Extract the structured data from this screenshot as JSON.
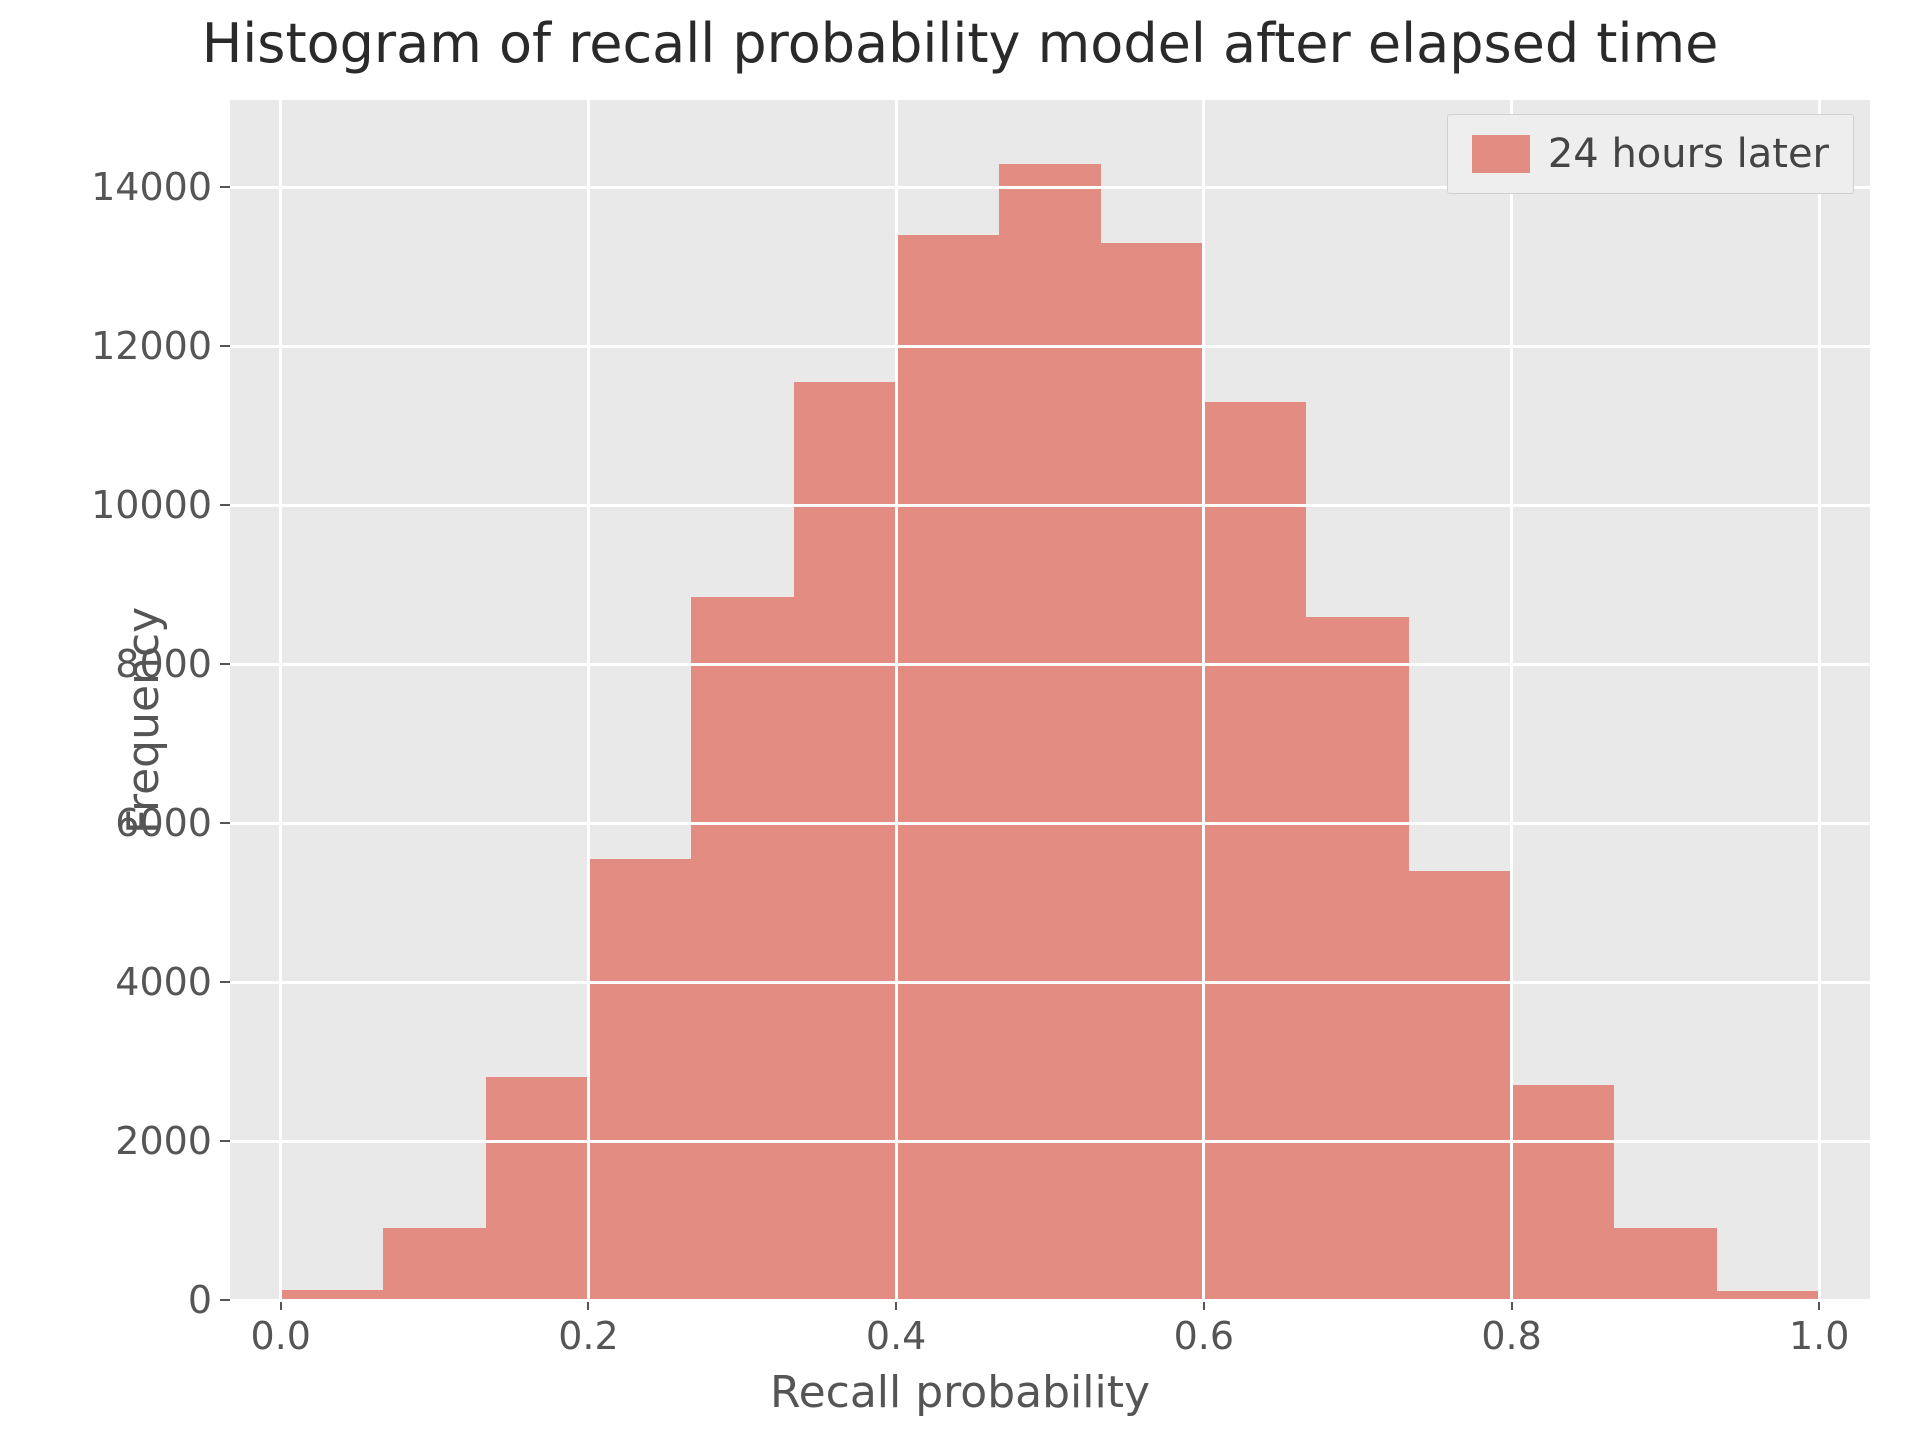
{
  "chart_data": {
    "type": "bar",
    "title": "Histogram of recall probability model after elapsed time",
    "xlabel": "Recall probability",
    "ylabel": "Frequency",
    "xlim": [
      -0.033,
      1.033
    ],
    "ylim": [
      0,
      15100
    ],
    "x_ticks": [
      0.0,
      0.2,
      0.4,
      0.6,
      0.8,
      1.0
    ],
    "x_tick_labels": [
      "0.0",
      "0.2",
      "0.4",
      "0.6",
      "0.8",
      "1.0"
    ],
    "y_ticks": [
      0,
      2000,
      4000,
      6000,
      8000,
      10000,
      12000,
      14000
    ],
    "y_tick_labels": [
      "0",
      "2000",
      "4000",
      "6000",
      "8000",
      "10000",
      "12000",
      "14000"
    ],
    "bin_width": 0.0667,
    "bin_edges": [
      0.0,
      0.0667,
      0.1333,
      0.2,
      0.2667,
      0.3333,
      0.4,
      0.4667,
      0.5333,
      0.6,
      0.6667,
      0.7333,
      0.8,
      0.8667,
      0.9333,
      1.0
    ],
    "counts": [
      120,
      900,
      2800,
      5550,
      8850,
      11550,
      13400,
      14300,
      13300,
      11300,
      8600,
      5400,
      2700,
      900,
      110
    ],
    "series": [
      {
        "name": "24 hours later"
      }
    ],
    "legend_position": "upper right",
    "bar_color": "#e38c81",
    "panel_bg": "#e9e9e9",
    "grid_color": "#ffffff"
  }
}
